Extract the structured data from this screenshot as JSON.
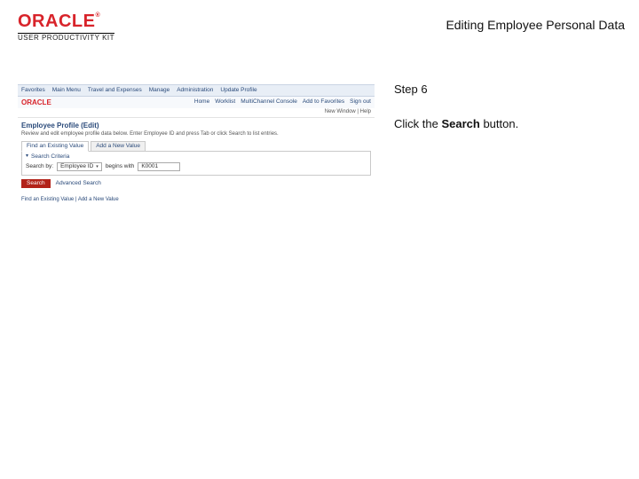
{
  "header": {
    "logo_text": "ORACLE",
    "logo_tm": "®",
    "subbrand": "USER PRODUCTIVITY KIT",
    "topic_title": "Editing Employee Personal Data"
  },
  "instruction": {
    "step_label": "Step 6",
    "text_before": "Click the ",
    "bold": "Search",
    "text_after": " button."
  },
  "screenshot": {
    "tabrow": [
      "Favorites",
      "Main Menu",
      "Travel and Expenses",
      "Manage",
      "Administration",
      "Update Profile"
    ],
    "brand": "ORACLE",
    "toplinks": [
      "Home",
      "Worklist",
      "MultiChannel Console",
      "Add to Favorites",
      "Sign out"
    ],
    "appline": "New Window | Help",
    "section_title": "Employee Profile (Edit)",
    "blurb": "Review and edit employee profile data below. Enter Employee ID and press Tab or click Search to list entries.",
    "mini_tabs": [
      "Find an Existing Value",
      "Add a New Value"
    ],
    "collapse_label": "Search Criteria",
    "search_by_label": "Search by:",
    "search_by_value": "Employee ID",
    "search_prefix": "begins with",
    "search_field": "K0001",
    "search_button": "Search",
    "adv_link": "Advanced Search",
    "footlink": "Find an Existing Value  |  Add a New Value"
  }
}
